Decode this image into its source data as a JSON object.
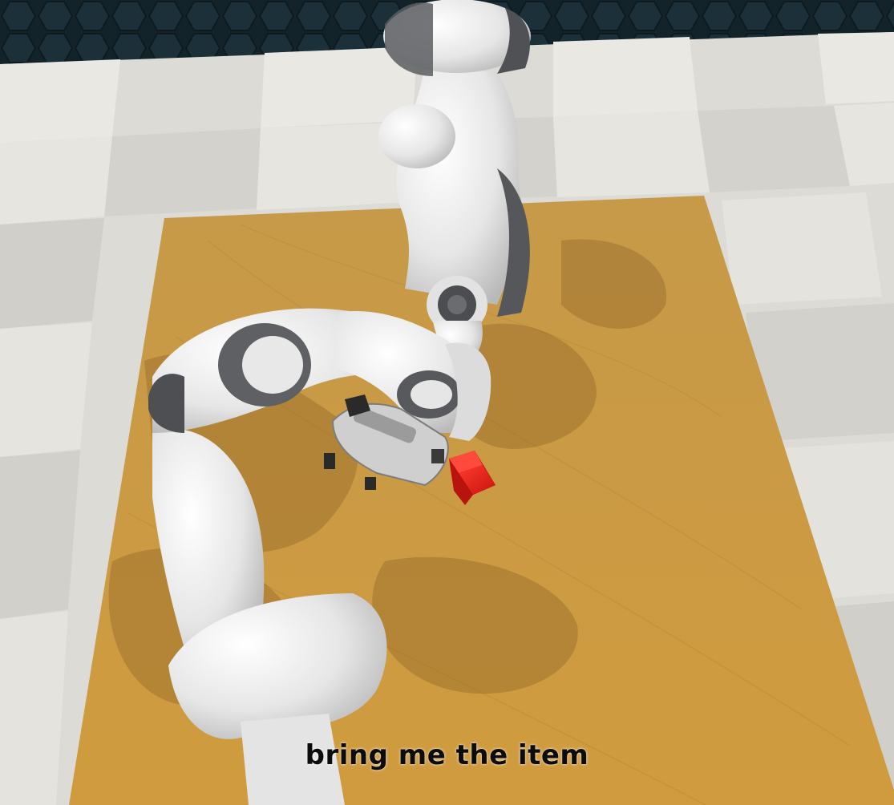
{
  "scene": {
    "caption": "bring me the item",
    "colors": {
      "backdrop": "#16262b",
      "floor_light": "#e7e6e1",
      "floor_dark": "#cfcecb",
      "table": "#c99a45",
      "arm_white": "#eeeeee",
      "arm_grey": "#5b5d60",
      "cube": "#e8231c"
    },
    "objects": [
      "robot-arm-back",
      "robot-arm-front",
      "gripper",
      "red-cube",
      "wooden-table"
    ]
  }
}
